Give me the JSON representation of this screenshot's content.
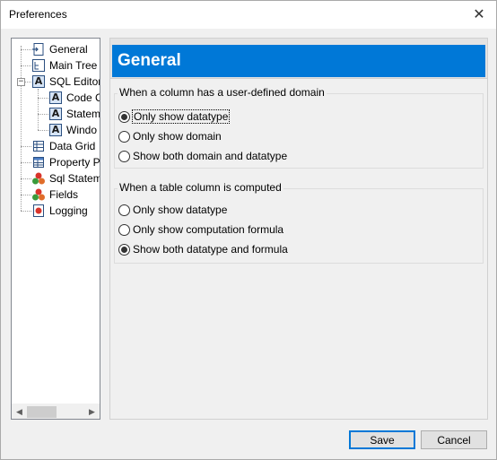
{
  "window": {
    "title": "Preferences"
  },
  "tree": {
    "items": [
      {
        "label": "General",
        "icon": "page-arrow-icon"
      },
      {
        "label": "Main Tree",
        "icon": "tree-icon"
      },
      {
        "label": "SQL Editor",
        "icon": "letter-a-icon"
      },
      {
        "label": "Code C",
        "icon": "letter-a-icon"
      },
      {
        "label": "Statem",
        "icon": "letter-a-icon"
      },
      {
        "label": "Windo",
        "icon": "letter-a-icon"
      },
      {
        "label": "Data Grid",
        "icon": "grid-icon"
      },
      {
        "label": "Property P",
        "icon": "property-grid-icon"
      },
      {
        "label": "Sql Statem",
        "icon": "shapes-icon"
      },
      {
        "label": "Fields",
        "icon": "shapes-icon"
      },
      {
        "label": "Logging",
        "icon": "log-icon"
      }
    ]
  },
  "panel": {
    "title": "General",
    "groups": [
      {
        "label": "When a column has a user-defined domain",
        "options": [
          "Only show datatype",
          "Only show domain",
          "Show both domain and datatype"
        ],
        "selected": 0
      },
      {
        "label": "When a table column is computed",
        "options": [
          "Only show datatype",
          "Only show computation formula",
          "Show both datatype and formula"
        ],
        "selected": 2
      }
    ]
  },
  "buttons": {
    "save": "Save",
    "cancel": "Cancel"
  },
  "colors": {
    "accent": "#0078d7"
  }
}
